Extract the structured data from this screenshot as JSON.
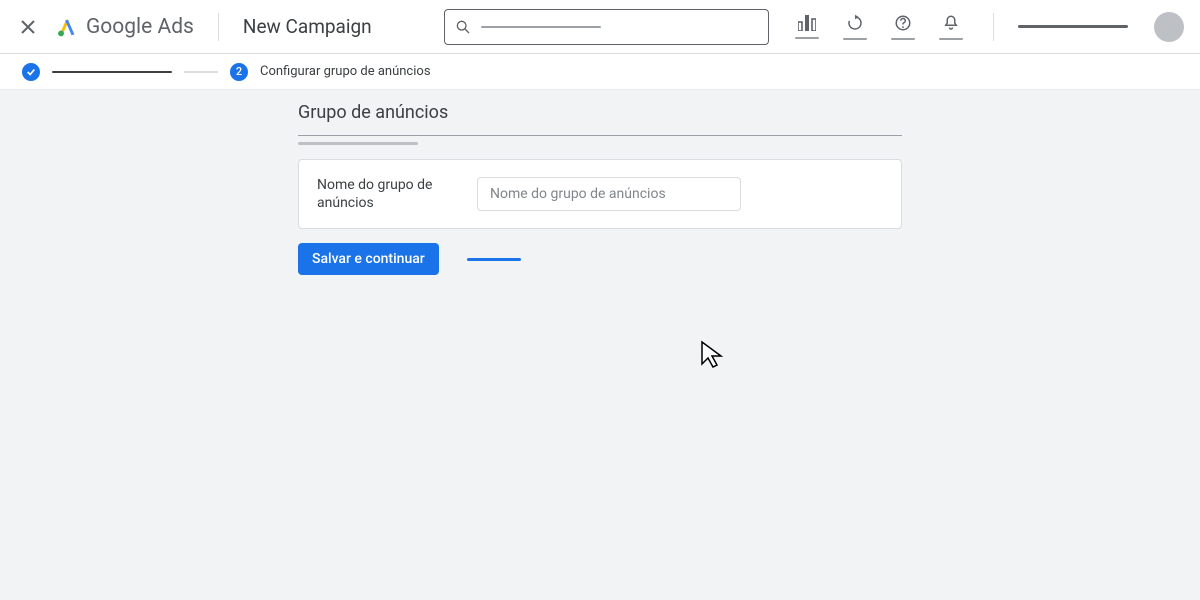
{
  "header": {
    "product_name_1": "Google",
    "product_name_2": "Ads",
    "page_title": "New Campaign",
    "search_placeholder": ""
  },
  "stepper": {
    "step2_number": "2",
    "step2_label": "Configurar grupo de anúncios"
  },
  "main": {
    "section_title": "Grupo de anúncios",
    "adgroup_label": "Nome do grupo de anúncios",
    "adgroup_input_placeholder": "Nome do grupo de anúncios",
    "save_btn": "Salvar e continuar"
  },
  "colors": {
    "primary": "#1a73e8",
    "text": "#3c4043",
    "muted": "#5f6368",
    "border": "#dadce0",
    "bg": "#f1f3f4"
  },
  "icons": {
    "close": "close-icon",
    "search": "search-icon",
    "reports": "reports-icon",
    "refresh": "refresh-icon",
    "help": "help-icon",
    "notifications": "notifications-icon",
    "check": "check-icon"
  }
}
